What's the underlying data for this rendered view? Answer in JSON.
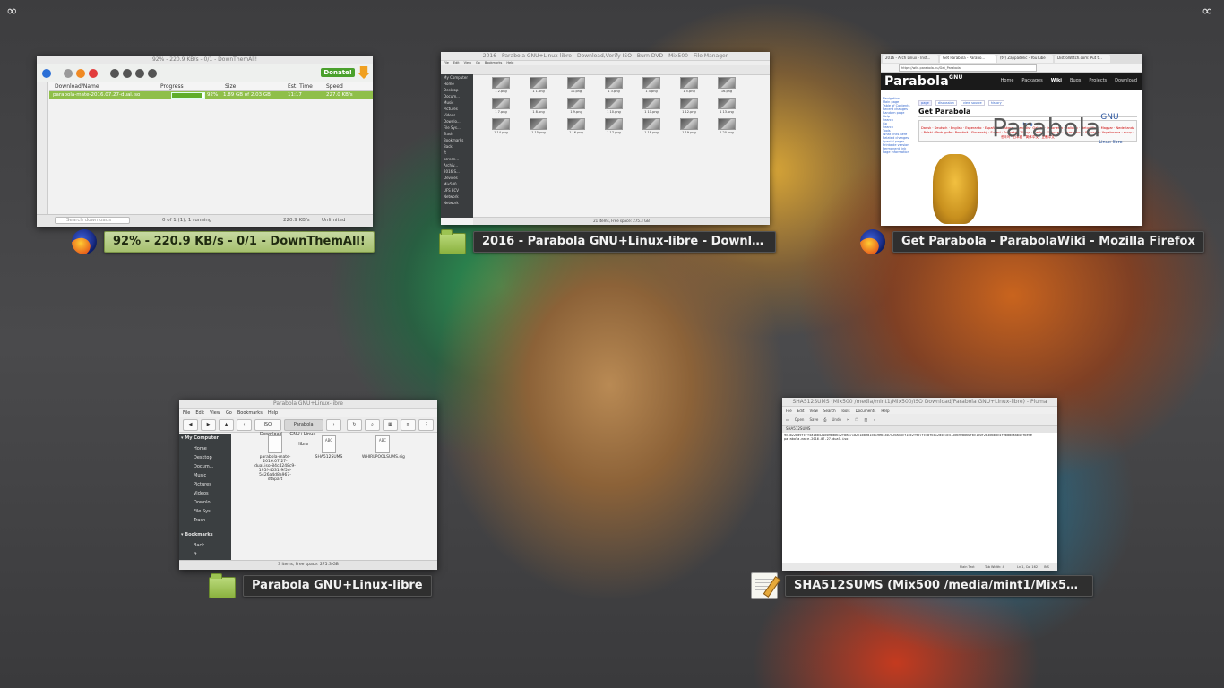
{
  "corners": {
    "left_icon": "infinity-icon",
    "right_icon": "infinity-icon",
    "glyph": "∞"
  },
  "windows": {
    "downthemall": {
      "title": "92% - 220.9 KB/s - 0/1 - DownThemAll!",
      "caption": "92% - 220.9 KB/s - 0/1 - DownThemAll!",
      "app_icon": "firefox-icon",
      "donate": "Donate!",
      "columns": [
        "Download/Name",
        "Progress",
        "Size",
        "Est. Time",
        "Speed"
      ],
      "row": {
        "name": "parabola-mate-2016.07.27-dual.iso",
        "progress_text": "92%",
        "progress_fraction": 0.92,
        "size": "1.89 GB of 2.03 GB",
        "est_time": "11:17",
        "speed": "227.0 KB/s"
      },
      "search_placeholder": "Search downloads",
      "status_running": "0 of 1 (1), 1 running",
      "status_speed": "220.9 KB/s",
      "status_limit": "Unlimited"
    },
    "files2016": {
      "title": "2016 - Parabola GNU+Linux-libre - Download,Verify ISO - Burn DVD - Mix500 - File Manager",
      "caption": "2016 - Parabola GNU+Linux-libre - Download,Veri...",
      "app_icon": "folder-icon",
      "menu": [
        "File",
        "Edit",
        "View",
        "Go",
        "Bookmarks",
        "Help"
      ],
      "sidebar": [
        "My Computer",
        "Home",
        "Desktop",
        "Docum...",
        "Music",
        "Pictures",
        "Videos",
        "Downlo...",
        "File Sys...",
        "Trash",
        "Bookmarks",
        "Back",
        "ft",
        "screen...",
        "Archiv...",
        "2016 S...",
        "Devices",
        "Mix500",
        "UFS ECV",
        "Network",
        "Network"
      ],
      "files": [
        "1 2.png",
        "1 1.png",
        "10.png",
        "1 3.png",
        "1 4.png",
        "1 5.png",
        "16.png",
        "1 7.png",
        "1 8.png",
        "1 9.png",
        "1 10.png",
        "1 11.png",
        "1 12.png",
        "1 13.png",
        "1 14.png",
        "1 15.png",
        "1 16.png",
        "1 17.png",
        "1 18.png",
        "1 19.png",
        "1 20.png"
      ],
      "status": "21 items, Free space: 275.3 GB"
    },
    "wiki": {
      "title": "Get Parabola - ParabolaWiki - Mozilla Firefox",
      "caption": "Get Parabola - ParabolaWiki - Mozilla Firefox",
      "app_icon": "firefox-icon",
      "tabs": [
        "2016 - Arch Linux - Inst...",
        "Get Parabola - Parabo...",
        "(tv) Zappadelic - YouTube",
        "DistroWatch.com: Put t..."
      ],
      "url": "https://wiki.parabola.nu/Get_Parabola",
      "logo": "Parabola",
      "logo_sup": "GNU",
      "nav": [
        "Home",
        "Packages",
        "Wiki",
        "Bugs",
        "Projects",
        "Download"
      ],
      "page_tabs": [
        "page",
        "discussion",
        "view source",
        "history"
      ],
      "sidebar": [
        "Navigation",
        "Main page",
        "Table of Contents",
        "Recent changes",
        "Random page",
        "Help",
        "Search",
        "Go",
        "Search",
        "Tools",
        "What links here",
        "Related changes",
        "Special pages",
        "Printable version",
        "Permanent link",
        "Page information"
      ],
      "heading": "Get Parabola",
      "lang_label": "Lang",
      "languages": "Dansk · Deutsch · English · Esperanto · Español · Euskara · Français · Galego · Indonesia · Italiano · Lietuviškai · Magyar · Nederlands · Polski · Português · Română · Slovenský · Suomi · Svenska · Türkçe · Česky · Ελληνικά · Български · Русский · Українська · עברית · 한국어 · 日本語 · 简体中文 · 正體中文",
      "banner_text": "Parabola",
      "banner_sup": "GNU",
      "banner_sub": "Linux-libre"
    },
    "iso_files": {
      "title": "Parabola GNU+Linux-libre",
      "caption": "Parabola GNU+Linux-libre",
      "app_icon": "folder-icon",
      "menu": [
        "File",
        "Edit",
        "View",
        "Go",
        "Bookmarks",
        "Help"
      ],
      "path": [
        "ISO Download",
        "Parabola GNU+Linux-libre"
      ],
      "sidebar_header": "My Computer",
      "sidebar": [
        "Home",
        "Desktop",
        "Docum...",
        "Music",
        "Pictures",
        "Videos",
        "Downlo...",
        "File Sys...",
        "Trash"
      ],
      "bookmarks_header": "Bookmarks",
      "bookmarks": [
        "Back",
        "ft"
      ],
      "files": [
        {
          "name": "parabola-mate-2016.07.27-dual.iso-84c4248c9-195f-4031-9f5d-5426a4d8a967-dtapart",
          "glyph": ""
        },
        {
          "name": "SHA512SUMS",
          "glyph": "ABC"
        },
        {
          "name": "WHIRLPOOLSUMS.sig",
          "glyph": "ABC"
        }
      ],
      "status": "3 items, Free space: 275.3 GB"
    },
    "editor": {
      "title": "SHA512SUMS (Mix500 /media/mint1/Mix500/ISO Download/Parabola GNU+Linux-libre) - Pluma",
      "caption": "SHA512SUMS (Mix500 /media/mint1/Mix500/ISO ...",
      "app_icon": "text-editor-icon",
      "menu": [
        "File",
        "Edit",
        "View",
        "Search",
        "Tools",
        "Documents",
        "Help"
      ],
      "toolbar": [
        "Open",
        "Save",
        "Undo"
      ],
      "tab": "SHA512SUMS",
      "content_hash": "9c3b228d9fcff5a160521b09bdb632fbea71a2c1b09d1cb19e64407c26a45cf1bc2f997fc4bf6c12d5e3c512b692bb60f6c1c0f2b3b6b0c4f9bddca8b4cf6e9e",
      "content_file": "parabola-mate-2016.07.27-dual.iso",
      "status_lang": "Plain Text",
      "status_tab": "Tab Width: 4",
      "status_pos": "Ln 1, Col 162",
      "status_ins": "INS"
    }
  },
  "colors": {
    "active_caption": "#a6c06e",
    "dta_progress": "#8fbf4a",
    "wiki_bar": "#1a1a1a"
  }
}
